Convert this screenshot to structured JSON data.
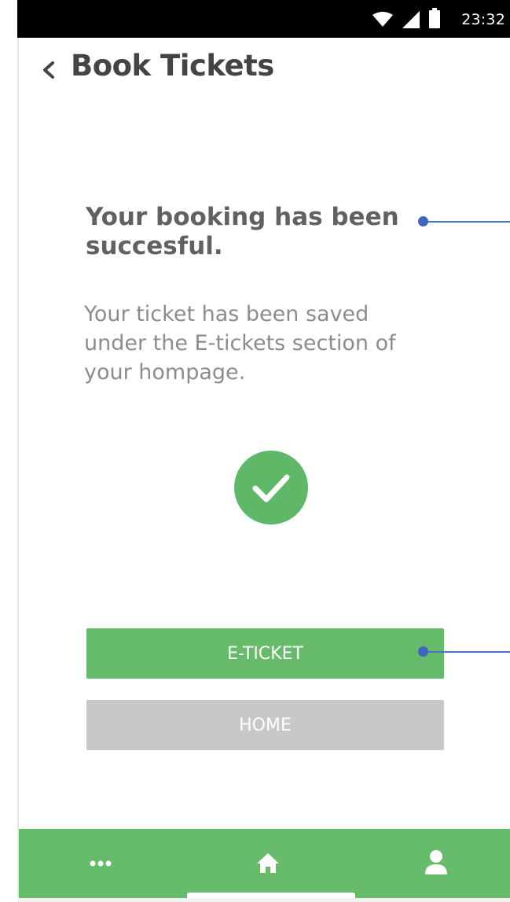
{
  "status_bar": {
    "time": "23:32",
    "icons": [
      "wifi-icon",
      "signal-icon",
      "battery-icon"
    ]
  },
  "header": {
    "back_icon": "chevron-left-icon",
    "title": "Book Tickets"
  },
  "confirmation": {
    "headline": "Your booking has been succesful.",
    "message": "Your ticket has been saved\n under the E-tickets section of\nyour hompage.",
    "success_icon": "check-circle-icon"
  },
  "actions": {
    "eticket_label": "E-TICKET",
    "home_label": "HOME"
  },
  "bottom_nav": {
    "items": [
      {
        "icon": "more-dots-icon"
      },
      {
        "icon": "home-icon"
      },
      {
        "icon": "user-icon"
      }
    ],
    "active": "home"
  },
  "colors": {
    "accent_green": "#66bb6a",
    "success_green": "#5fb868",
    "disabled_gray": "#c8c8c8",
    "annotation_blue": "#3e66c0"
  }
}
